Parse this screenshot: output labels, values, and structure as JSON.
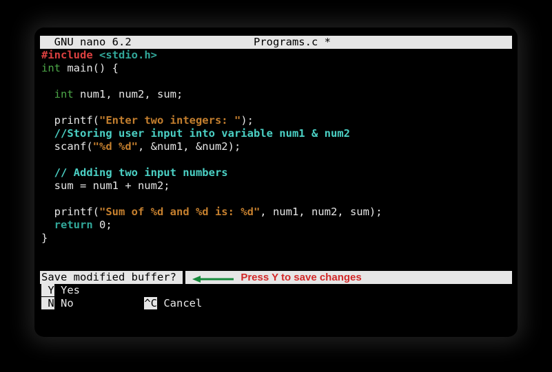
{
  "titlebar": {
    "editor_name": "GNU nano 6.2",
    "filename": "Programs.c",
    "modified_flag": "*"
  },
  "code": {
    "include_kw": "#include",
    "include_lib": "<stdio.h>",
    "type_int": "int",
    "main_sig": " main() {",
    "decl_rest": " num1, num2, sum;",
    "printf1_pre": "  printf(",
    "str_enter": "\"Enter two integers: \"",
    "printf1_post": ");",
    "comment_store": "//Storing user input into variable num1 & num2",
    "scanf_pre": "  scanf(",
    "str_fmt": "\"%d %d\"",
    "scanf_post": ", &num1, &num2);",
    "comment_add": "// Adding two input numbers",
    "sum_line": "  sum = num1 + num2;",
    "printf2_pre": "  printf(",
    "str_sum": "\"Sum of %d and %d is: %d\"",
    "printf2_post": ", num1, num2, sum);",
    "return_kw": "return",
    "return_rest": " 0;",
    "close_brace": "}"
  },
  "prompt": {
    "question": "Save modified buffer? "
  },
  "annotation": {
    "arrow_color": "#178a3c",
    "text": "Press Y to save changes"
  },
  "options": {
    "yes_key": " Y",
    "yes_label": " Yes",
    "no_key": " N",
    "no_label": " No",
    "cancel_key": "^C",
    "cancel_label": " Cancel"
  }
}
